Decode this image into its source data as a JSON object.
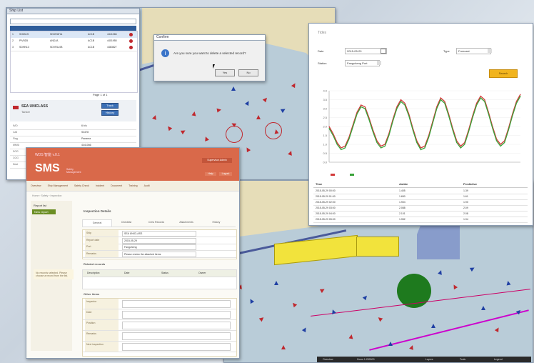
{
  "top_map_window": {
    "title": "Ship List",
    "ship_table": {
      "rows": [
        {
          "no": "1",
          "name": "SOMLIS",
          "ship_no": "SKDRATIA",
          "type": "AC1B",
          "mmsi": "4441066",
          "status": "red"
        },
        {
          "no": "2",
          "name": "PIV5D5",
          "ship_no": "ANDJA",
          "type": "AC1B",
          "mmsi": "4401955",
          "status": "red"
        },
        {
          "no": "3",
          "name": "SDHN13",
          "ship_no": "SDVRA-0B",
          "type": "AC1B",
          "mmsi": "4483827",
          "status": "red"
        }
      ]
    },
    "pager": "Page 1 of 1",
    "ship_detail": {
      "name": "SEA UNICLASS",
      "sub": "Tanker",
      "fields": [
        {
          "k": "IMO",
          "v": "6 b/s"
        },
        {
          "k": "Call",
          "v": "S3478"
        },
        {
          "k": "Flag",
          "v": "Panama"
        },
        {
          "k": "MMSI",
          "v": "4441066"
        },
        {
          "k": "SOG",
          "v": "0.4"
        },
        {
          "k": "COG",
          "v": "2.11"
        },
        {
          "k": "Dest",
          "v": "—"
        }
      ],
      "buttons": [
        "Track",
        "History"
      ]
    }
  },
  "dialog": {
    "title": "Confirm",
    "message": "Are you sure you want to delete a selected record?",
    "yes": "Yes",
    "no": "No"
  },
  "tide_window": {
    "title": "Tides",
    "date_label": "Date",
    "date_value": "2015-05-29",
    "station_label": "Station",
    "station_value": "Fangcheng Port",
    "type_label": "Type",
    "type_value": "Forecast",
    "search_button": "Search",
    "table_headers": [
      "Time",
      "Astide",
      "Predictive"
    ],
    "table_rows": [
      [
        "2015-05-29 00:00",
        "1.405",
        "1.39"
      ],
      [
        "2015-05-29 01:00",
        "1.650",
        "1.61"
      ],
      [
        "2015-05-29 02:00",
        "1.904",
        "1.90"
      ],
      [
        "2015-05-29 03:00",
        "2.088",
        "2.09"
      ],
      [
        "2015-05-29 04:00",
        "2.101",
        "2.08"
      ],
      [
        "2015-05-29 05:00",
        "1.952",
        "1.94"
      ]
    ],
    "chart_data": {
      "type": "line",
      "x": [
        0,
        2,
        4,
        6,
        8,
        10,
        12,
        14,
        16,
        18,
        20,
        22,
        24,
        26,
        28,
        30,
        32,
        34,
        36,
        38,
        40,
        42,
        44,
        46,
        48,
        50,
        52,
        54,
        56,
        58,
        60,
        62,
        64,
        66,
        68,
        70,
        72,
        74,
        76,
        78,
        80,
        82,
        84,
        86,
        88,
        90,
        92,
        94,
        96
      ],
      "series": [
        {
          "name": "",
          "color": "#d23a3a",
          "values": [
            2.0,
            1.6,
            1.1,
            0.8,
            0.9,
            1.4,
            2.1,
            2.8,
            3.2,
            3.1,
            2.5,
            1.8,
            1.2,
            0.9,
            1.0,
            1.6,
            2.4,
            3.1,
            3.5,
            3.3,
            2.7,
            1.9,
            1.2,
            0.8,
            0.9,
            1.5,
            2.3,
            3.1,
            3.6,
            3.4,
            2.7,
            1.9,
            1.2,
            0.9,
            1.1,
            1.8,
            2.6,
            3.3,
            3.7,
            3.5,
            2.8,
            2.0,
            1.3,
            1.0,
            1.2,
            1.9,
            2.7,
            3.4,
            3.8
          ]
        },
        {
          "name": "",
          "color": "#3aa33a",
          "values": [
            1.9,
            1.5,
            1.0,
            0.7,
            0.8,
            1.3,
            2.0,
            2.7,
            3.1,
            3.0,
            2.4,
            1.7,
            1.1,
            0.8,
            0.9,
            1.5,
            2.3,
            3.0,
            3.4,
            3.2,
            2.6,
            1.8,
            1.1,
            0.7,
            0.8,
            1.4,
            2.2,
            3.0,
            3.5,
            3.3,
            2.6,
            1.8,
            1.1,
            0.8,
            1.0,
            1.7,
            2.5,
            3.2,
            3.6,
            3.4,
            2.7,
            1.9,
            1.2,
            0.9,
            1.1,
            1.8,
            2.6,
            3.3,
            3.7
          ]
        }
      ],
      "ylim": [
        0,
        4
      ],
      "yticks": [
        "4.0",
        "3.5",
        "3.0",
        "2.5",
        "2.0",
        "1.5",
        "1.0",
        "0.5",
        "0.0"
      ]
    }
  },
  "sms_window": {
    "brand": "SMS",
    "brand_sub": "Safety Management",
    "header_tag": "WDS 智能 v.0.1",
    "header_right": "Supervisor Admin",
    "header_btns": [
      "Help",
      "Logout"
    ],
    "nav": [
      "Overview",
      "Ship Management",
      "Safety Check",
      "Incident",
      "Document",
      "Training",
      "Audit"
    ],
    "breadcrumb": "Home › Safety › Inspection",
    "left_menu": [
      "Report list",
      "New report"
    ],
    "left_note": "No records selected. Please choose a record from the list.",
    "section_title": "Inspection Details",
    "tabs": [
      "General",
      "Checklist",
      "Crew Records",
      "Attachments",
      "History"
    ],
    "form_rows": [
      {
        "label": "Ship",
        "value": "SEA UNICLASS"
      },
      {
        "label": "Report date",
        "value": "2015-05-29"
      },
      {
        "label": "Port",
        "value": "Fangcheng"
      },
      {
        "label": "Remarks",
        "value": "Please review the attached items"
      }
    ],
    "subsection": "Related records",
    "sub_headers": [
      "Description",
      "Date",
      "Status",
      "Owner"
    ],
    "other_title": "Other items",
    "other_rows": [
      {
        "label": "Inspector",
        "value": ""
      },
      {
        "label": "Date",
        "value": ""
      },
      {
        "label": "Position",
        "value": ""
      },
      {
        "label": "Remarks",
        "value": ""
      },
      {
        "label": "Next inspection",
        "value": ""
      }
    ]
  },
  "bottom_map": {
    "status_items": [
      "Overview",
      "Zoom 1:250000",
      "",
      "Layers",
      "Tools",
      "Legend"
    ]
  }
}
